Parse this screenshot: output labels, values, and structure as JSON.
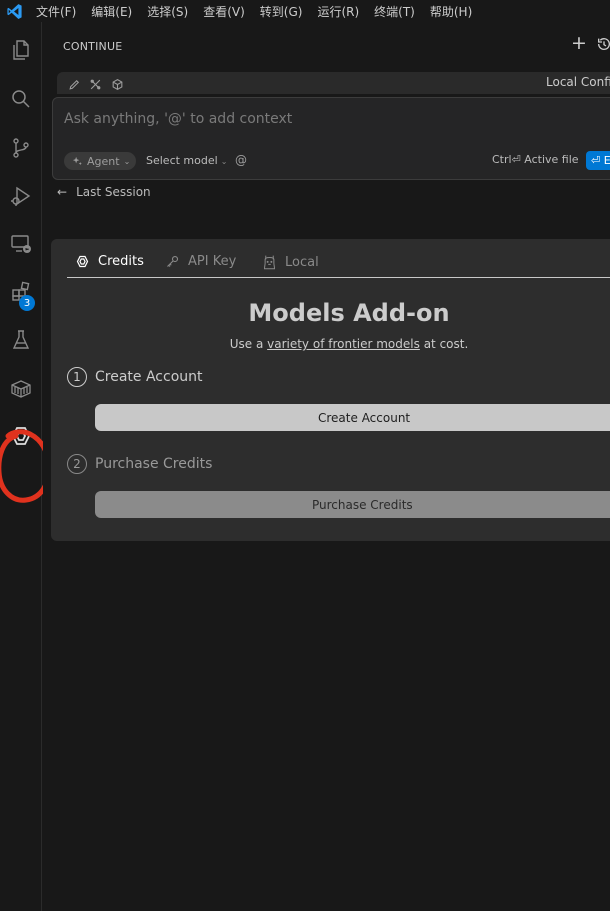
{
  "titlebar": {
    "menu": [
      "文件(F)",
      "编辑(E)",
      "选择(S)",
      "查看(V)",
      "转到(G)",
      "运行(R)",
      "终端(T)",
      "帮助(H)"
    ]
  },
  "activitybar": {
    "extensions_badge": "3",
    "icons": [
      "files-icon",
      "search-icon",
      "source-control-icon",
      "run-debug-icon",
      "remote-explorer-icon",
      "extensions-icon",
      "testing-icon",
      "containers-icon",
      "continue-icon"
    ]
  },
  "sidebar": {
    "header": "CONTINUE",
    "toolbar": {
      "config_label": "Local Config"
    },
    "input": {
      "placeholder": "Ask anything, '@' to add context",
      "mode": "Agent",
      "model": "Select model",
      "at": "@",
      "active_file": "Ctrl⏎ Active file",
      "enter": "⏎ E"
    },
    "last_session": "Last Session"
  },
  "card": {
    "tabs": [
      {
        "label": "Credits",
        "active": true
      },
      {
        "label": "API Key",
        "active": false
      },
      {
        "label": "Local",
        "active": false
      }
    ],
    "title": "Models Add-on",
    "subtitle_pre": "Use a ",
    "subtitle_link": "variety of frontier models",
    "subtitle_post": " at cost.",
    "step1": {
      "num": "1",
      "label": "Create Account",
      "button": "Create Account"
    },
    "step2": {
      "num": "2",
      "label": "Purchase Credits",
      "button": "Purchase Credits"
    }
  },
  "colors": {
    "accent": "#0078d4",
    "annotation": "#e0321e"
  }
}
